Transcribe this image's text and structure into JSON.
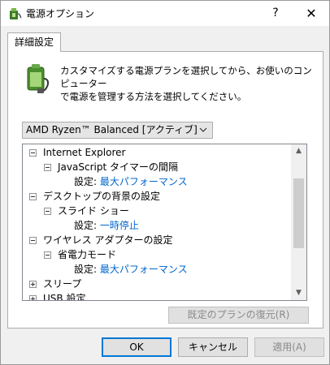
{
  "window": {
    "title": "電源オプション",
    "help_label": "?",
    "close_label": "✕",
    "icon": "power-plug-icon"
  },
  "tab": {
    "label": "詳細設定"
  },
  "description": {
    "line1": "カスタマイズする電源プランを選択してから、お使いのコンピューター",
    "line2": "で電源を管理する方法を選択してください。",
    "icon": "battery-plug-icon"
  },
  "plan_select": {
    "value": "AMD Ryzen™ Balanced [アクティブ]"
  },
  "tree": {
    "items": [
      {
        "label": "Internet Explorer",
        "expander": "minus"
      },
      {
        "label": "JavaScript タイマーの間隔",
        "expander": "minus"
      },
      {
        "setting_label": "設定:",
        "value": "最大パフォーマンス"
      },
      {
        "label": "デスクトップの背景の設定",
        "expander": "minus"
      },
      {
        "label": "スライド ショー",
        "expander": "minus"
      },
      {
        "setting_label": "設定:",
        "value": "一時停止"
      },
      {
        "label": "ワイヤレス アダプターの設定",
        "expander": "minus"
      },
      {
        "label": "省電力モード",
        "expander": "minus"
      },
      {
        "setting_label": "設定:",
        "value": "最大パフォーマンス"
      },
      {
        "label": "スリープ",
        "expander": "plus"
      },
      {
        "label": "USB 設定",
        "expander": "plus"
      }
    ]
  },
  "restore_button": {
    "label": "既定のプランの復元(R)"
  },
  "buttons": {
    "ok": "OK",
    "cancel": "キャンセル",
    "apply": "適用(A)"
  },
  "colors": {
    "setting_value": "#0066cc",
    "focus_border": "#0078d7"
  }
}
